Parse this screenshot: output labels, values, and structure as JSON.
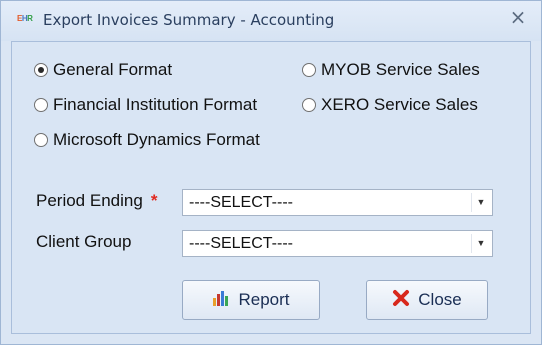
{
  "window": {
    "title": "Export Invoices Summary - Accounting",
    "app_icon_text": [
      "E",
      "H",
      "R"
    ]
  },
  "formats": {
    "general": "General Format",
    "financial": "Financial Institution Format",
    "microsoft": "Microsoft Dynamics Format",
    "myob": "MYOB Service Sales",
    "xero": "XERO Service Sales",
    "selected": "general"
  },
  "period_ending": {
    "label": "Period Ending",
    "required_marker": "*",
    "value": "----SELECT----"
  },
  "client_group": {
    "label": "Client Group",
    "value": "----SELECT----"
  },
  "buttons": {
    "report": "Report",
    "close": "Close"
  },
  "colors": {
    "accent": "#1a2e54",
    "required": "#e0281f",
    "close_icon": "#d8281c"
  }
}
